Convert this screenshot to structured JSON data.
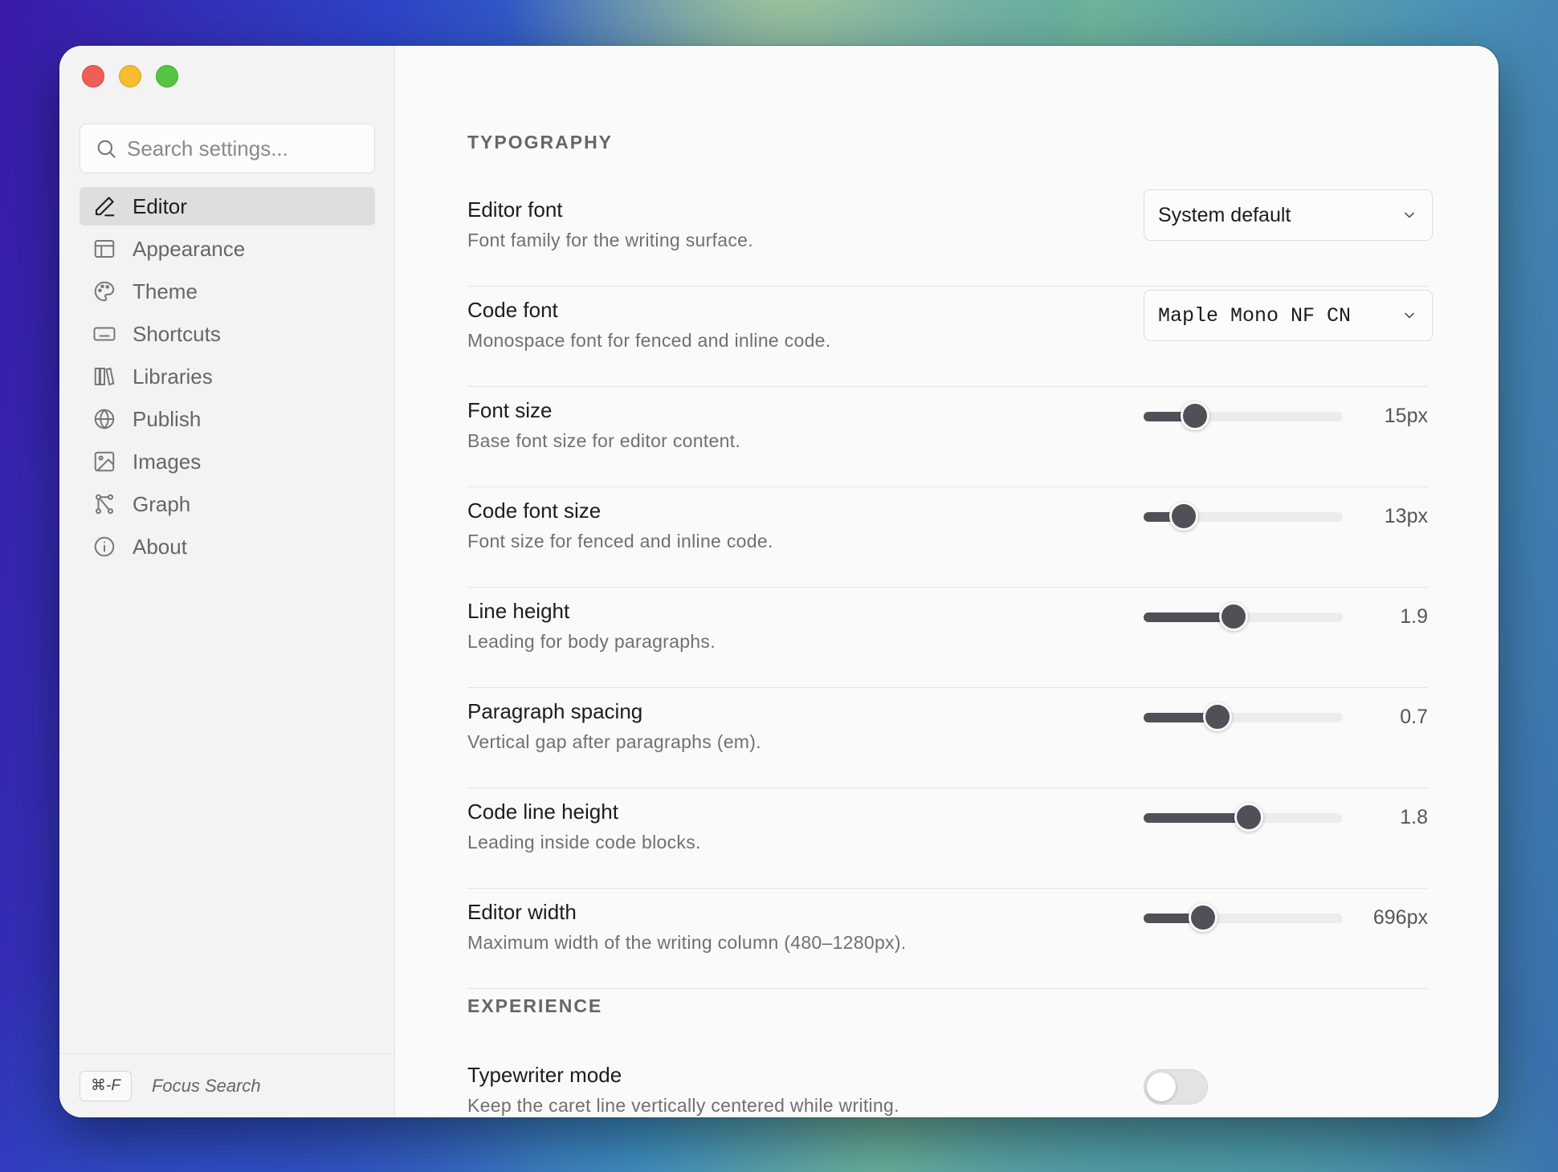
{
  "sidebar": {
    "search_placeholder": "Search settings...",
    "items": [
      {
        "label": "Editor",
        "icon": "pencil-icon",
        "active": true
      },
      {
        "label": "Appearance",
        "icon": "layout-icon"
      },
      {
        "label": "Theme",
        "icon": "palette-icon"
      },
      {
        "label": "Shortcuts",
        "icon": "keyboard-icon"
      },
      {
        "label": "Libraries",
        "icon": "library-icon"
      },
      {
        "label": "Publish",
        "icon": "globe-icon"
      },
      {
        "label": "Images",
        "icon": "image-icon"
      },
      {
        "label": "Graph",
        "icon": "graph-icon"
      },
      {
        "label": "About",
        "icon": "info-icon"
      }
    ],
    "footer": {
      "shortcut": "⌘-F",
      "label": "Focus Search"
    }
  },
  "sections": {
    "typography": "TYPOGRAPHY",
    "experience": "EXPERIENCE"
  },
  "settings": {
    "editor_font": {
      "label": "Editor font",
      "desc": "Font family for the writing surface.",
      "value": "System default"
    },
    "code_font": {
      "label": "Code font",
      "desc": "Monospace font for fenced and inline code.",
      "value": "Maple Mono NF CN"
    },
    "font_size": {
      "label": "Font size",
      "desc": "Base font size for editor content.",
      "value": "15px",
      "level": 0.26
    },
    "code_font_size": {
      "label": "Code font size",
      "desc": "Font size for fenced and inline code.",
      "value": "13px",
      "level": 0.2
    },
    "line_height": {
      "label": "Line height",
      "desc": "Leading for body paragraphs.",
      "value": "1.9",
      "level": 0.45
    },
    "paragraph_spacing": {
      "label": "Paragraph spacing",
      "desc": "Vertical gap after paragraphs (em).",
      "value": "0.7",
      "level": 0.37
    },
    "code_line_height": {
      "label": "Code line height",
      "desc": "Leading inside code blocks.",
      "value": "1.8",
      "level": 0.53
    },
    "editor_width": {
      "label": "Editor width",
      "desc": "Maximum width of the writing column (480–1280px).",
      "value": "696px",
      "level": 0.3
    },
    "typewriter_mode": {
      "label": "Typewriter mode",
      "desc": "Keep the caret line vertically centered while writing.",
      "enabled": false
    }
  },
  "colors": {
    "accent": "#505058",
    "track": "#ececec",
    "active_nav": "#dedede"
  }
}
